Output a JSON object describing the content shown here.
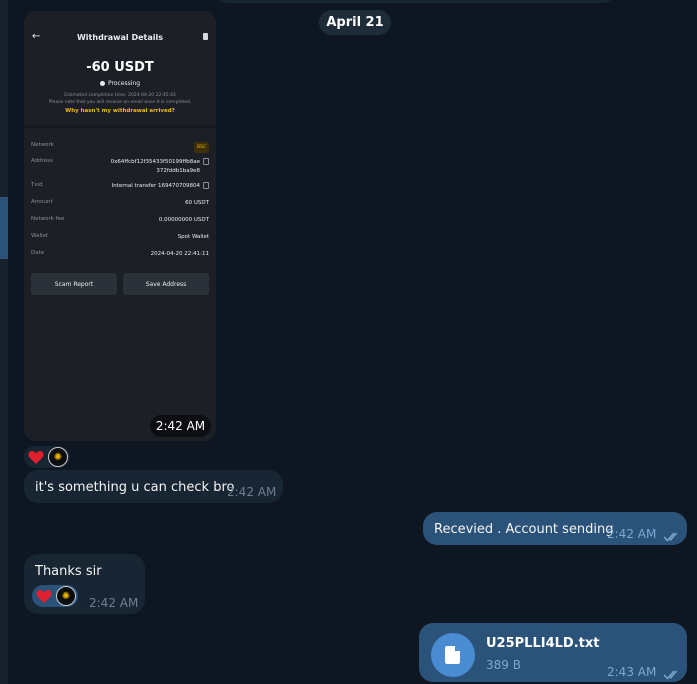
{
  "chat": {
    "date_divider": "April 21",
    "screenshot_message": {
      "header_title": "Withdrawal Details",
      "amount": "-60 USDT",
      "status": "Processing",
      "estimated_text": "Estimated completion time: 2024-04-20 22:45:43",
      "email_note": "Please note that you will receive an email once it is completed.",
      "help_link": "Why hasn't my withdrawal arrived?",
      "details": [
        {
          "key": "Network",
          "value": "BSC"
        },
        {
          "key": "Address",
          "value": "0x64ffcbf12f35433f50199ffb8ae",
          "value2": "372fddb1ba9e8"
        },
        {
          "key": "Txid",
          "value": "Internal transfer 169470709804"
        },
        {
          "key": "Amount",
          "value": "60 USDT"
        },
        {
          "key": "Network fee",
          "value": "0.00000000 USDT"
        },
        {
          "key": "Wallet",
          "value": "Spot Wallet"
        },
        {
          "key": "Date",
          "value": "2024-04-20 22:41:11"
        }
      ],
      "buttons": {
        "scam_report": "Scam Report",
        "save_address": "Save Address"
      },
      "time": "2:42 AM"
    },
    "messages": [
      {
        "text": "it's something u can check bro",
        "time": "2:42 AM",
        "direction": "incoming"
      },
      {
        "text": "Recevied . Account sending",
        "time": "2:42 AM",
        "direction": "outgoing"
      },
      {
        "text": "Thanks sir",
        "time": "2:42 AM",
        "direction": "incoming"
      }
    ],
    "file_message": {
      "file_name": "U25PLLI4LD.txt",
      "file_size": "389 B",
      "time": "2:43 AM"
    },
    "reactions": [
      "heart-icon",
      "avatar-icon"
    ]
  },
  "colors": {
    "background": "#0e1621",
    "incoming_bubble": "#182533",
    "outgoing_bubble": "#2b5278",
    "accent": "#4a8cd2",
    "binance_yellow": "#f0b90b"
  }
}
